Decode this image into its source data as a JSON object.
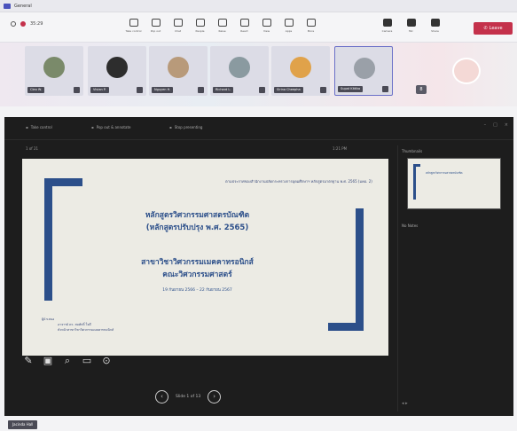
{
  "titlebar": {
    "title": "General"
  },
  "toolbar": {
    "time": "35:29",
    "tools": [
      {
        "label": "Take control",
        "icon": "screen-icon"
      },
      {
        "label": "Pop out",
        "icon": "popout-icon"
      },
      {
        "label": "Chat",
        "icon": "chat-icon"
      },
      {
        "label": "People",
        "icon": "people-icon"
      },
      {
        "label": "Raise",
        "icon": "hand-icon"
      },
      {
        "label": "React",
        "icon": "react-icon"
      },
      {
        "label": "View",
        "icon": "view-icon"
      },
      {
        "label": "Apps",
        "icon": "apps-icon"
      },
      {
        "label": "More",
        "icon": "more-icon"
      }
    ],
    "right_tools": [
      {
        "label": "Camera",
        "icon": "camera-icon"
      },
      {
        "label": "Mic",
        "icon": "mic-icon"
      },
      {
        "label": "Share",
        "icon": "share-icon"
      }
    ],
    "leave_label": "Leave"
  },
  "participants": [
    {
      "name": "Cleo W.",
      "avatar_color": "#7a8a6a"
    },
    {
      "name": "Vivian P.",
      "avatar_color": "#2d2d2d"
    },
    {
      "name": "Nguyen H.",
      "avatar_color": "#b89a7a"
    },
    {
      "name": "Richard L.",
      "avatar_color": "#8a9aa0"
    },
    {
      "name": "Sirina Cheepha",
      "avatar_color": "#e0a24a"
    },
    {
      "name": "Supat Kittiko",
      "avatar_color": "#9aa0a8"
    }
  ],
  "overflow_count": "8",
  "stage": {
    "top_buttons": [
      "Take control",
      "Pop out & annotate",
      "Stop presenting"
    ],
    "slide_header_left": "1 of 21",
    "slide_header_right": "1:21 PM",
    "side_title": "Thumbnails",
    "side_notes": "No Notes",
    "pager_label": "Slide 1 of 13"
  },
  "slide": {
    "topright": "ตามประกาศของสำนักงานปลัดกระทรวงการอุดมศึกษาฯ หลักสูตรมาตรฐาน พ.ศ. 2565 (มคอ. 2)",
    "title1_line1": "หลักสูตรวิศวกรรมศาสตรบัณฑิต",
    "title1_line2": "(หลักสูตรปรับปรุง พ.ศ. 2565)",
    "title2_line1": "สาขาวิชาวิศวกรรมเมคคาทรอนิกส์",
    "title2_line2": "คณะวิศวกรรมศาสตร์",
    "date": "19 กันยายน 2566 – 22 กันยายน 2567",
    "footer_line1": "ผู้นำเสนอ",
    "footer_line2": "อาจารย์ ดร. สมศักดิ์ ใจดี",
    "footer_line3": "หัวหน้าสาขาวิชาวิศวกรรมเมคคาทรอนิกส์"
  },
  "bottom_chip": "Jacinda Hall"
}
